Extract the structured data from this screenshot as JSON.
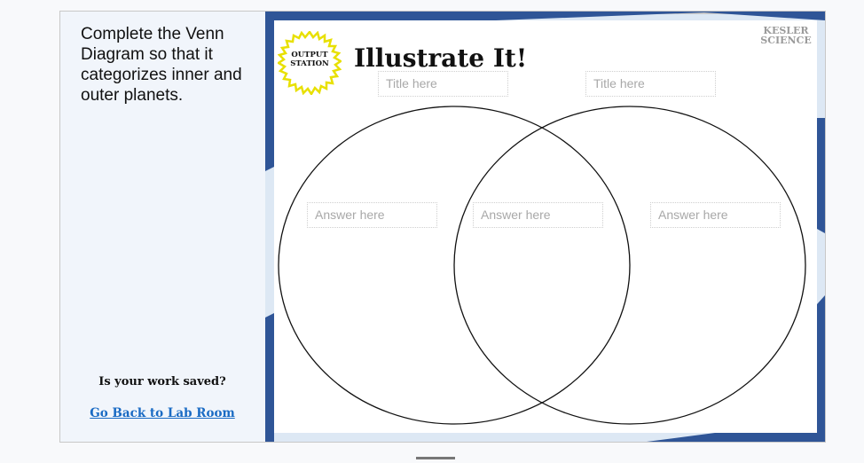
{
  "sidebar": {
    "prompt": "Complete the Venn Diagram so that it categorizes inner and outer planets.",
    "saved_question": "Is your work saved?",
    "back_link": "Go Back to Lab Room"
  },
  "slide": {
    "badge": "OUTPUT STATION",
    "title": "Illustrate It!",
    "logo": "KESLER SCIENCE",
    "title_fields": [
      {
        "placeholder": "Title here"
      },
      {
        "placeholder": "Title here"
      }
    ],
    "answer_fields": [
      {
        "placeholder": "Answer here"
      },
      {
        "placeholder": "Answer here"
      },
      {
        "placeholder": "Answer here"
      }
    ]
  },
  "colors": {
    "frame_blue": "#2f5597",
    "light_blue": "#dde8f4",
    "link": "#1a6bc4"
  }
}
